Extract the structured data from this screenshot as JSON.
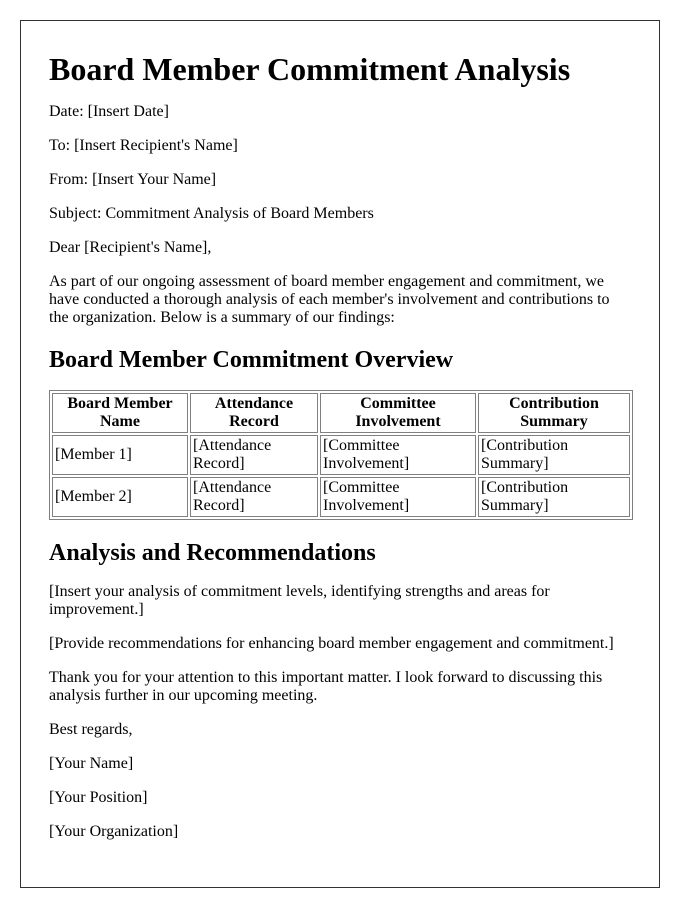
{
  "title": "Board Member Commitment Analysis",
  "header_fields": {
    "date": "Date: [Insert Date]",
    "to": "To: [Insert Recipient's Name]",
    "from": "From: [Insert Your Name]",
    "subject": "Subject: Commitment Analysis of Board Members"
  },
  "salutation": "Dear [Recipient's Name],",
  "intro": "As part of our ongoing assessment of board member engagement and commitment, we have conducted a thorough analysis of each member's involvement and contributions to the organization. Below is a summary of our findings:",
  "overview": {
    "heading": "Board Member Commitment Overview",
    "columns": [
      "Board Member Name",
      "Attendance Record",
      "Committee Involvement",
      "Contribution Summary"
    ],
    "rows": [
      [
        "[Member 1]",
        "[Attendance Record]",
        "[Committee Involvement]",
        "[Contribution Summary]"
      ],
      [
        "[Member 2]",
        "[Attendance Record]",
        "[Committee Involvement]",
        "[Contribution Summary]"
      ]
    ]
  },
  "analysis": {
    "heading": "Analysis and Recommendations",
    "paragraphs": [
      "[Insert your analysis of commitment levels, identifying strengths and areas for improvement.]",
      "[Provide recommendations for enhancing board member engagement and commitment.]",
      "Thank you for your attention to this important matter. I look forward to discussing this analysis further in our upcoming meeting."
    ]
  },
  "closing": {
    "sign_off": "Best regards,",
    "name": "[Your Name]",
    "position": "[Your Position]",
    "organization": "[Your Organization]"
  }
}
